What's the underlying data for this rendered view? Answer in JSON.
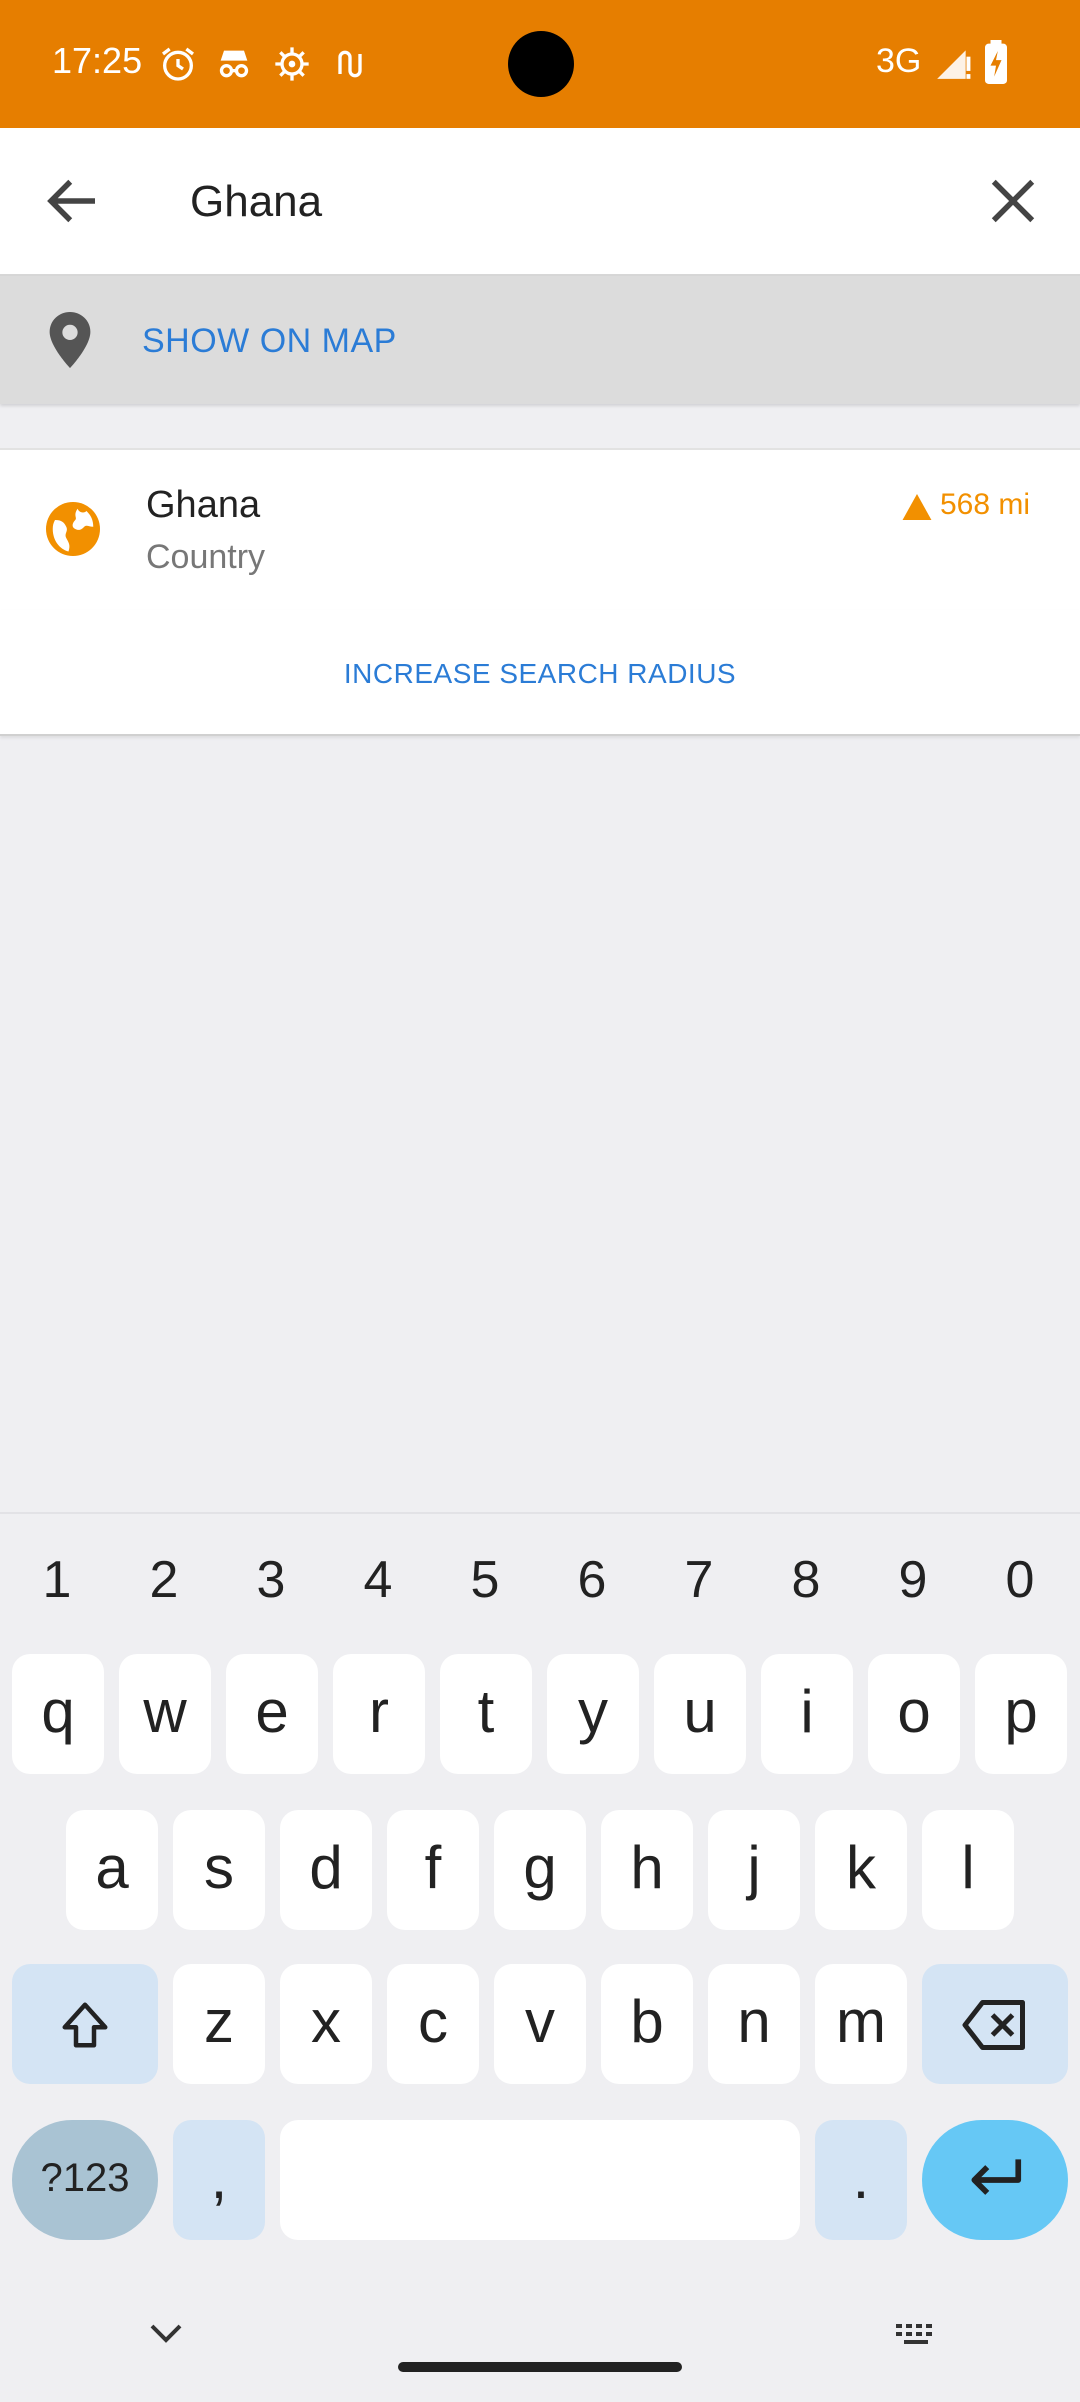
{
  "status_bar": {
    "time": "17:25",
    "network": "3G",
    "icons": [
      "alarm-icon",
      "incognito-icon",
      "settings-gear-icon",
      "vpn-icon",
      "signal-icon",
      "battery-charging-icon"
    ]
  },
  "search": {
    "value": "Ghana",
    "placeholder": ""
  },
  "show_on_map": {
    "label": "SHOW ON MAP"
  },
  "results": [
    {
      "name": "Ghana",
      "type": "Country",
      "distance": "568 mi",
      "icon": "globe-icon"
    }
  ],
  "increase_radius": {
    "label": "INCREASE SEARCH RADIUS"
  },
  "keyboard": {
    "number_row": [
      "1",
      "2",
      "3",
      "4",
      "5",
      "6",
      "7",
      "8",
      "9",
      "0"
    ],
    "row1": [
      "q",
      "w",
      "e",
      "r",
      "t",
      "y",
      "u",
      "i",
      "o",
      "p"
    ],
    "row2": [
      "a",
      "s",
      "d",
      "f",
      "g",
      "h",
      "j",
      "k",
      "l"
    ],
    "row3": [
      "z",
      "x",
      "c",
      "v",
      "b",
      "n",
      "m"
    ],
    "symbols_label": "?123",
    "comma": ",",
    "period": "."
  },
  "colors": {
    "status_bar": "#e67e00",
    "accent_blue": "#2b7cd6",
    "accent_orange": "#f29000",
    "enter_key": "#66c8f5"
  }
}
